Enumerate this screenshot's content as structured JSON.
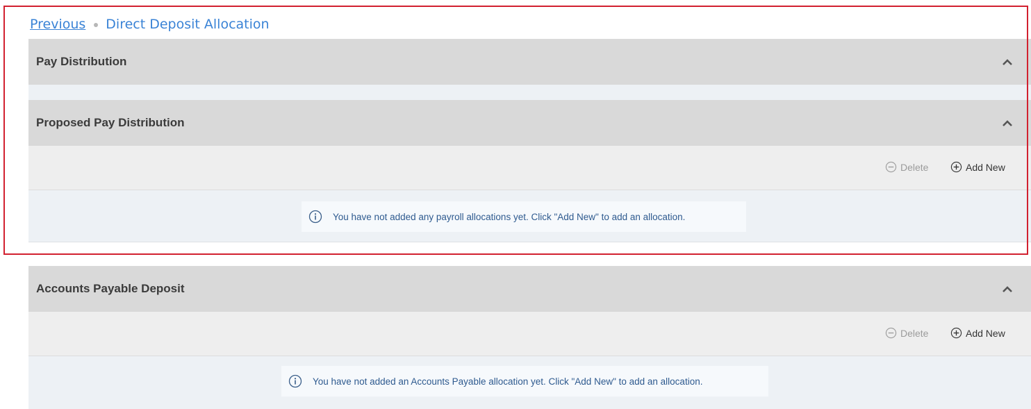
{
  "breadcrumb": {
    "previous": "Previous",
    "current": "Direct Deposit Allocation"
  },
  "panels": {
    "pay_distribution": {
      "title": "Pay Distribution",
      "collapse_icon": "chevron-up-icon"
    },
    "proposed_pay_distribution": {
      "title": "Proposed Pay Distribution",
      "collapse_icon": "chevron-up-icon",
      "delete_label": "Delete",
      "add_label": "Add New",
      "message": "You have not added any payroll allocations yet. Click \"Add New\" to add an allocation."
    },
    "accounts_payable_deposit": {
      "title": "Accounts Payable Deposit",
      "collapse_icon": "chevron-up-icon",
      "delete_label": "Delete",
      "add_label": "Add New",
      "message": "You have not added an Accounts Payable allocation yet. Click \"Add New\" to add an allocation."
    }
  },
  "icons": {
    "delete": "minus-circle-icon",
    "add": "plus-circle-icon",
    "info": "info-icon"
  },
  "colors": {
    "link": "#3a83d6",
    "header_bg": "#d9d9d9",
    "band_bg": "#edf1f5",
    "toolbar_bg": "#eeeeee",
    "message_text": "#2e5a8f",
    "highlight_border": "#d2202f"
  }
}
